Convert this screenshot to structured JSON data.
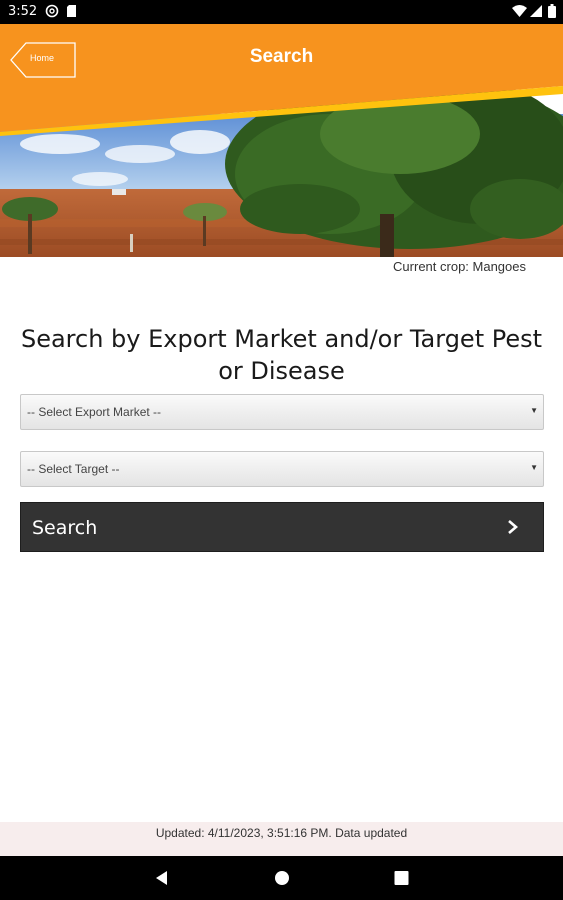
{
  "status_bar": {
    "time": "3:52",
    "icons": [
      "at-sign-icon",
      "sd-card-icon",
      "wifi-icon",
      "signal-icon",
      "battery-icon"
    ]
  },
  "header": {
    "title": "Search",
    "home_label": "Home",
    "colors": {
      "orange": "#F7931E",
      "yellow": "#FFC20E"
    }
  },
  "crop_info": "Current crop: Mangoes",
  "heading": "Search by Export Market and/or Target Pest or Disease",
  "form": {
    "export_market_selected": "-- Select Export Market --",
    "target_selected": "-- Select Target --",
    "search_label": "Search"
  },
  "footer": {
    "updated_text": "Updated: 4/11/2023, 3:51:16 PM. Data updated"
  },
  "nav_bar": {
    "icons": [
      "back-icon",
      "home-icon",
      "recents-icon"
    ]
  }
}
